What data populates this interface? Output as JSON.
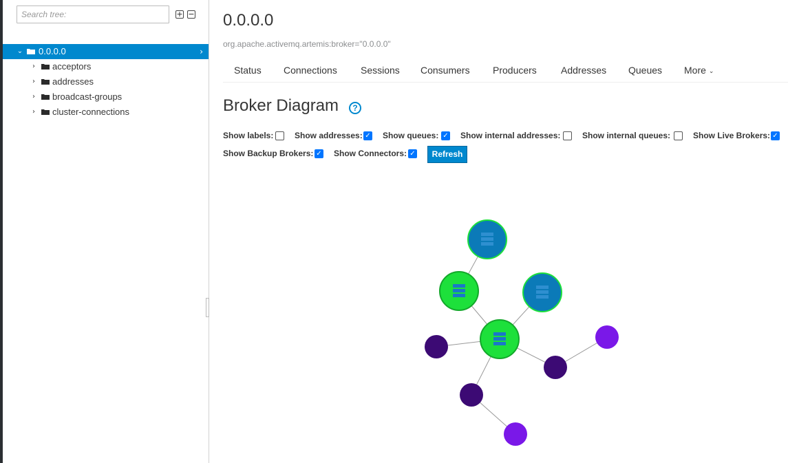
{
  "sidebar": {
    "search": {
      "placeholder": "Search tree:",
      "value": ""
    },
    "expand_label": "+",
    "collapse_label": "−",
    "tree": [
      {
        "label": "0.0.0.0",
        "selected": true,
        "expanded": true
      },
      {
        "label": "acceptors"
      },
      {
        "label": "addresses"
      },
      {
        "label": "broadcast-groups"
      },
      {
        "label": "cluster-connections"
      }
    ]
  },
  "main": {
    "title": "0.0.0.0",
    "mbean": "org.apache.activemq.artemis:broker=\"0.0.0.0\"",
    "tabs": [
      "Status",
      "Connections",
      "Sessions",
      "Consumers",
      "Producers",
      "Addresses",
      "Queues",
      "More"
    ],
    "diagram_title": "Broker Diagram",
    "help_label": "?",
    "options": [
      {
        "label": "Show labels:",
        "checked": false
      },
      {
        "label": "Show addresses:",
        "checked": true
      },
      {
        "label": "Show queues:",
        "checked": true
      },
      {
        "label": "Show internal addresses:",
        "checked": false
      },
      {
        "label": "Show internal queues:",
        "checked": false
      },
      {
        "label": "Show Live Brokers:",
        "checked": true
      },
      {
        "label": "Show Backup Brokers:",
        "checked": true
      },
      {
        "label": "Show Connectors:",
        "checked": true
      }
    ],
    "refresh_label": "Refresh"
  },
  "colors": {
    "selected_bg": "#0088ce",
    "live_broker": "#1de03b",
    "backup_broker": "#0b7ab8",
    "address": "#3c0a74",
    "queue": "#7a18e8",
    "accent": "#0088ce"
  },
  "icons": {
    "expand": "plus-square-icon",
    "collapse": "minus-square-icon",
    "folder": "folder-icon",
    "caret_right": "chevron-right-icon",
    "caret_down": "chevron-down-icon",
    "help": "question-circle-icon",
    "broker": "server-icon"
  }
}
